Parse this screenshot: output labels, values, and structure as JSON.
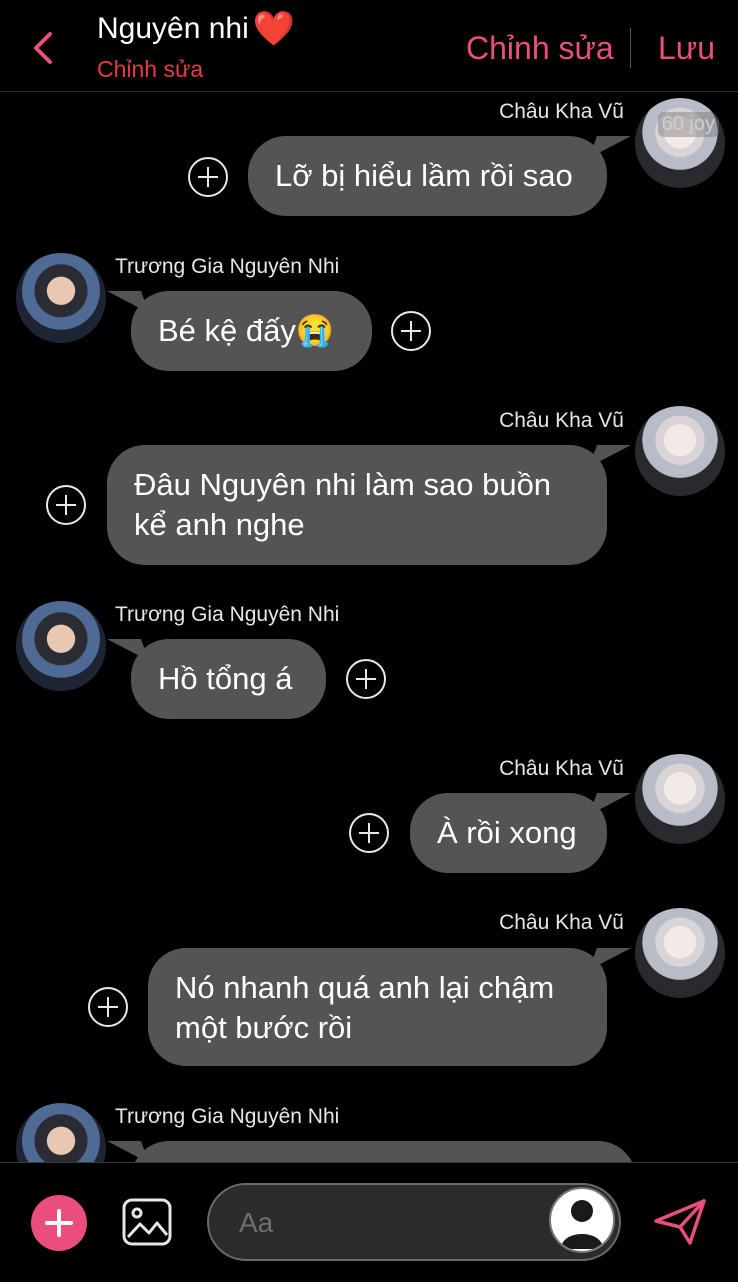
{
  "header": {
    "title": "Nguyên nhi",
    "heart": "❤️",
    "subtitle": "Chỉnh sửa",
    "edit_label": "Chỉnh sửa",
    "save_label": "Lưu"
  },
  "messages": [
    {
      "side": "right",
      "sender": "Châu Kha Vũ",
      "lines": [
        "Lỡ bị hiểu lầm rồi sao"
      ],
      "avatar_badge": "60 joy"
    },
    {
      "side": "left",
      "sender": "Trương Gia Nguyên Nhi",
      "lines": [
        "Bé kệ đấy😭"
      ]
    },
    {
      "side": "right",
      "sender": "Châu Kha Vũ",
      "lines": [
        "Đâu Nguyên nhi làm sao buồn",
        "kể anh nghe"
      ]
    },
    {
      "side": "left",
      "sender": "Trương Gia Nguyên Nhi",
      "lines": [
        "Hồ tổng á"
      ]
    },
    {
      "side": "right",
      "sender": "Châu Kha Vũ",
      "lines": [
        "À rồi xong"
      ]
    },
    {
      "side": "right",
      "sender": "Châu Kha Vũ",
      "lines": [
        "Nó nhanh quá anh lại chậm",
        "một bước rồi"
      ]
    },
    {
      "side": "left",
      "sender": "Trương Gia Nguyên Nhi",
      "lines": []
    }
  ],
  "composer": {
    "placeholder": "Aa"
  },
  "colors": {
    "accent": "#ea4e7e",
    "subtitle_red": "#e63b43",
    "bubble": "#545454",
    "background": "#000000"
  },
  "icons": {
    "back": "chevron-left-icon",
    "add": "plus-icon",
    "image": "image-icon",
    "send": "send-icon",
    "react": "plus-circle-icon"
  }
}
